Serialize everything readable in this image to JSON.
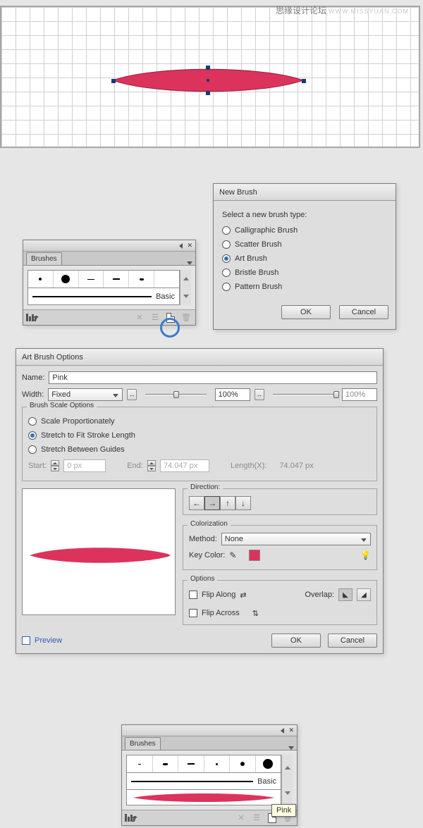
{
  "watermark": {
    "text": "思缘设计论坛",
    "url": "WWW.MISSYUAN.COM"
  },
  "colors": {
    "pink": "#dc335d",
    "ring": "#3b7bca"
  },
  "canvas_shape": {
    "fill": "#dc335d"
  },
  "brushes1": {
    "title": "Brushes",
    "basic_label": "Basic"
  },
  "new_brush": {
    "title": "New Brush",
    "prompt": "Select a new brush type:",
    "types": [
      "Calligraphic Brush",
      "Scatter Brush",
      "Art Brush",
      "Bristle Brush",
      "Pattern Brush"
    ],
    "selected_index": 2,
    "ok": "OK",
    "cancel": "Cancel"
  },
  "art_brush": {
    "title": "Art Brush Options",
    "name_label": "Name:",
    "name_value": "Pink",
    "width_label": "Width:",
    "width_type": "Fixed",
    "width_pct_a": "100%",
    "width_pct_b": "100%",
    "scale_legend": "Brush Scale Options",
    "scale_options": [
      "Scale Proportionately",
      "Stretch to Fit Stroke Length",
      "Stretch Between Guides"
    ],
    "scale_selected_index": 1,
    "start_label": "Start:",
    "start_value": "0 px",
    "end_label": "End:",
    "end_value": "74.047 px",
    "lengthx_label": "Length(X):",
    "lengthx_value": "74.047 px",
    "direction_legend": "Direction:",
    "color_legend": "Colorization",
    "method_label": "Method:",
    "method_value": "None",
    "keycolor_label": "Key Color:",
    "options_legend": "Options",
    "flip_along": "Flip Along",
    "flip_across": "Flip Across",
    "overlap_label": "Overlap:",
    "preview_label": "Preview",
    "ok": "OK",
    "cancel": "Cancel"
  },
  "brushes2": {
    "title": "Brushes",
    "basic_label": "Basic",
    "tooltip": "Pink"
  },
  "chart_data": null
}
